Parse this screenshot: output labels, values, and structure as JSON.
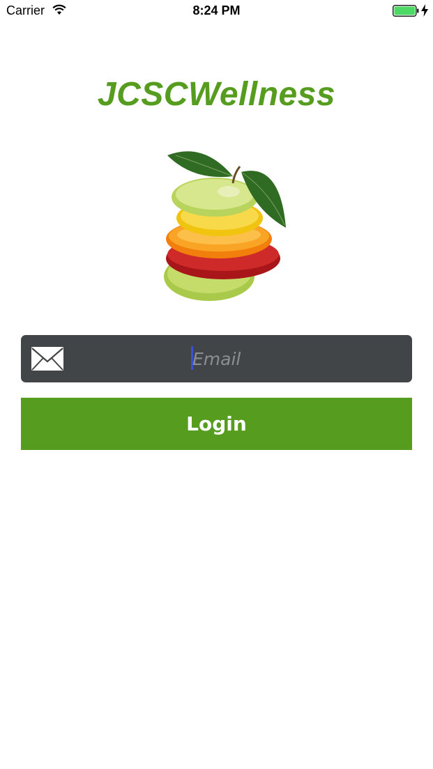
{
  "status_bar": {
    "carrier": "Carrier",
    "time": "8:24 PM",
    "battery_color": "#4cd964"
  },
  "app": {
    "title": "JCSCWellness",
    "title_color": "#569c1f",
    "logo_icon": "fruit-stack-logo"
  },
  "login_form": {
    "email_icon": "envelope-icon",
    "email_placeholder": "Email",
    "email_value": "",
    "field_color": "#424548",
    "login_label": "Login",
    "button_color": "#569c1f"
  }
}
